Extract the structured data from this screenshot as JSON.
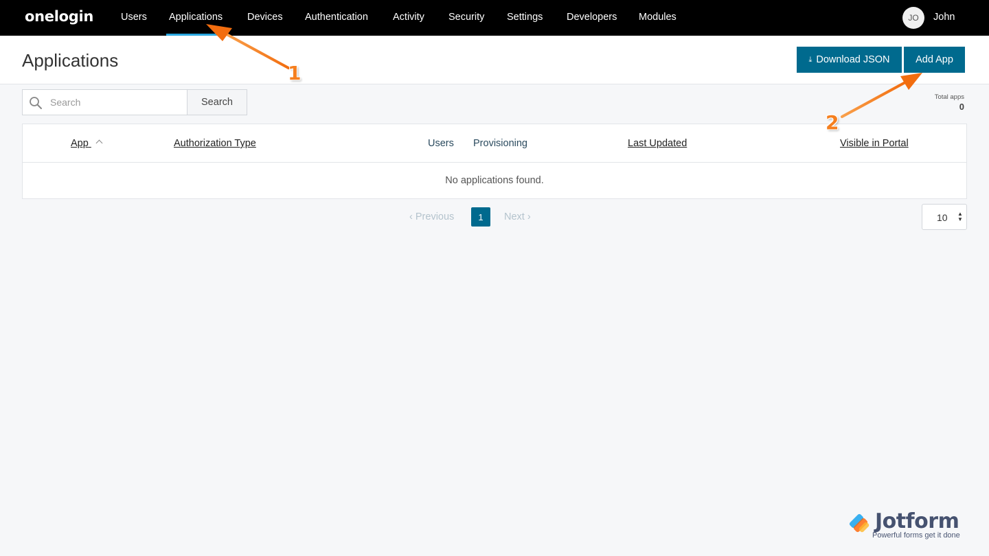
{
  "brand": {
    "logo_text": "onelogin"
  },
  "nav": {
    "items": [
      "Users",
      "Applications",
      "Devices",
      "Authentication",
      "Activity",
      "Security",
      "Settings",
      "Developers",
      "Modules"
    ],
    "active": "Applications",
    "user_initials": "JO",
    "user_name": "John"
  },
  "header": {
    "title": "Applications",
    "download_label": "Download JSON",
    "add_label": "Add App"
  },
  "search": {
    "placeholder": "Search",
    "button_label": "Search"
  },
  "totals": {
    "label": "Total apps",
    "value": "0"
  },
  "table": {
    "columns": [
      "App",
      "Authorization Type",
      "Users",
      "Provisioning",
      "Last Updated",
      "Visible in Portal"
    ],
    "empty_message": "No applications found."
  },
  "pagination": {
    "prev_label": "Previous",
    "current_page": "1",
    "next_label": "Next",
    "per_page": "10"
  },
  "annotations": {
    "step1": "1",
    "step2": "2",
    "color": "#f57f1f"
  },
  "watermark": {
    "name": "Jotform",
    "tagline": "Powerful forms get it done"
  },
  "colors": {
    "accent": "#006a8e",
    "nav_bg": "#000000",
    "active_underline": "#2aa7e0"
  }
}
